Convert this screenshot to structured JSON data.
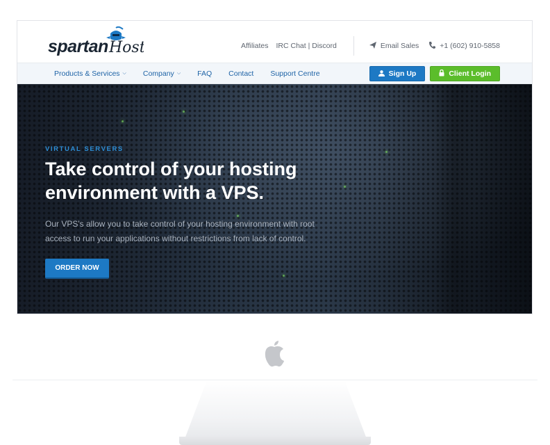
{
  "brand": {
    "logo_text": "spartanHost",
    "colors": {
      "primary": "#1d79c4",
      "success": "#5bbd2b",
      "hero_accent": "#2d8ed6"
    }
  },
  "top_links": {
    "affiliates": "Affiliates",
    "irc_chat": "IRC Chat | Discord",
    "email_sales": {
      "icon": "paper-plane-icon",
      "label": "Email Sales"
    },
    "phone": {
      "icon": "phone-icon",
      "label": "+1 (602) 910-5858"
    }
  },
  "nav": {
    "items": [
      {
        "label": "Products & Services",
        "has_dropdown": true
      },
      {
        "label": "Company",
        "has_dropdown": true
      },
      {
        "label": "FAQ",
        "has_dropdown": false
      },
      {
        "label": "Contact",
        "has_dropdown": false
      },
      {
        "label": "Support Centre",
        "has_dropdown": false
      }
    ],
    "signup": {
      "icon": "user-icon",
      "label": "Sign Up"
    },
    "login": {
      "icon": "lock-icon",
      "label": "Client Login"
    }
  },
  "hero": {
    "eyebrow": "VIRTUAL SERVERS",
    "title_line1": "Take control of your hosting",
    "title_line2": "environment with a VPS.",
    "body_line1": "Our VPS's allow you to take control of your hosting environment with root",
    "body_line2": "access to run your applications without restrictions from lack of control.",
    "cta": "ORDER NOW"
  },
  "device": {
    "logo": "apple-icon"
  }
}
